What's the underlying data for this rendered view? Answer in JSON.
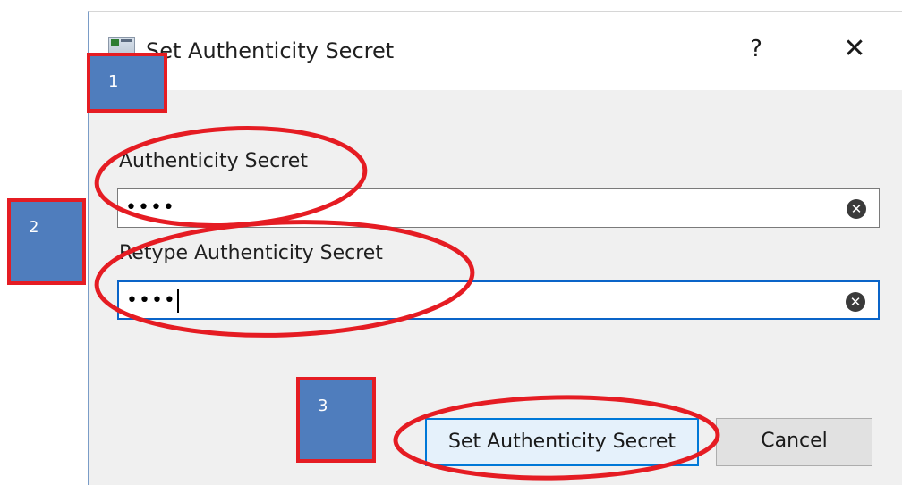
{
  "dialog": {
    "title": "Set Authenticity Secret",
    "help_label": "?",
    "close_label": "✕"
  },
  "fields": [
    {
      "label": "Authenticity Secret",
      "value": "••••",
      "focused": false
    },
    {
      "label": "Retype Authenticity Secret",
      "value": "••••",
      "focused": true
    }
  ],
  "clear_icon_glyph": "✕",
  "buttons": {
    "primary_label": "Set Authenticity Secret",
    "cancel_label": "Cancel"
  },
  "annotations": {
    "markers": [
      "1",
      "2",
      "3"
    ],
    "marker_color": "#4f7dbd",
    "highlight_color": "#e51c23"
  },
  "colors": {
    "focus_border": "#0a64c8",
    "primary_button_border": "#0078d7"
  },
  "icons": {
    "app": "app-window-icon",
    "help": "help-icon",
    "close": "close-icon",
    "clear": "clear-circle-icon"
  }
}
